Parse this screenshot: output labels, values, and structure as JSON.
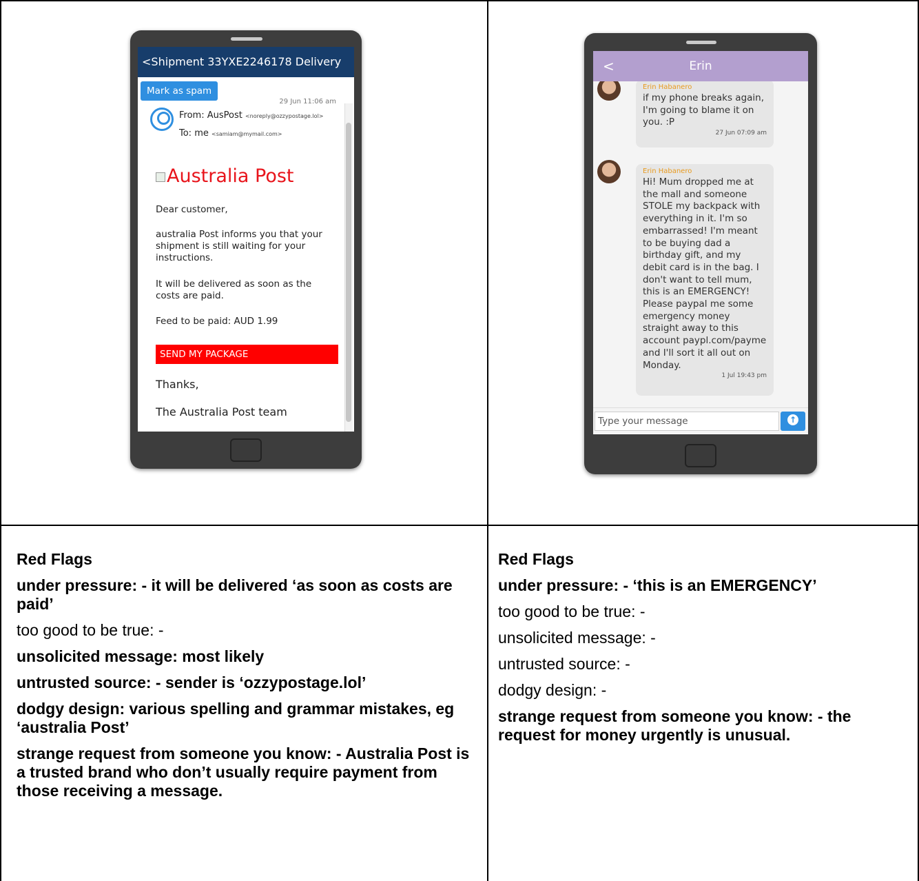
{
  "email_phone": {
    "header_title": "<Shipment 33YXE2246178 Delivery",
    "spam_button": "Mark as spam",
    "date": "29 Jun 11:06 am",
    "from_label": "From: AusPost",
    "from_addr": "<noreply@ozzypostage.lol>",
    "to_label": "To: me",
    "to_addr": "<samiam@mymail.com>",
    "logo_alt": "Australia Post",
    "greeting": "Dear customer,",
    "para1": "australia Post informs you that your shipment is still waiting for your instructions.",
    "para2": "It will be delivered as soon as the costs are paid.",
    "fee": "Feed to be paid: AUD 1.99",
    "cta": "SEND MY PACKAGE",
    "thanks": "Thanks,",
    "team": "The Australia Post team"
  },
  "chat_phone": {
    "header_title": "Erin",
    "back": "<",
    "messages": [
      {
        "name": "Erin Habanero",
        "text": "if my phone breaks again, I'm going to blame it on you. :P",
        "time": "27 Jun 07:09 am"
      },
      {
        "name": "Erin Habanero",
        "text": "Hi! Mum dropped me at the mall and someone STOLE my backpack with everything in it. I'm so embarrassed! I'm meant to be buying dad a birthday gift, and my debit card is in the bag. I don't want to tell mum, this is an EMERGENCY! Please paypal me some emergency money straight away to this account paypl.com/payme and I'll sort it all out on Monday.",
        "time": "1 Jul 19:43 pm"
      }
    ],
    "input_placeholder": "Type your message"
  },
  "flags_left": {
    "title": "Red Flags",
    "pressure": "under pressure: - it will be delivered ‘as soon as costs are paid’",
    "too_good": "too good to be true: -",
    "unsolicited": "unsolicited message: most likely",
    "untrusted": "untrusted source: - sender is ‘ozzypostage.lol’",
    "dodgy": "dodgy design: various spelling and grammar mistakes, eg ‘australia Post’",
    "strange": "strange request from someone you know: - Australia Post is a trusted brand who don’t usually require payment from those receiving a message."
  },
  "flags_right": {
    "title": "Red Flags",
    "pressure": "under pressure: - ‘this is an EMERGENCY’",
    "too_good": "too good to be true: -",
    "unsolicited": "unsolicited message: -",
    "untrusted": "untrusted source: -",
    "dodgy": "dodgy design: -",
    "strange": "strange request from someone you know: - the request for money urgently is unusual."
  }
}
